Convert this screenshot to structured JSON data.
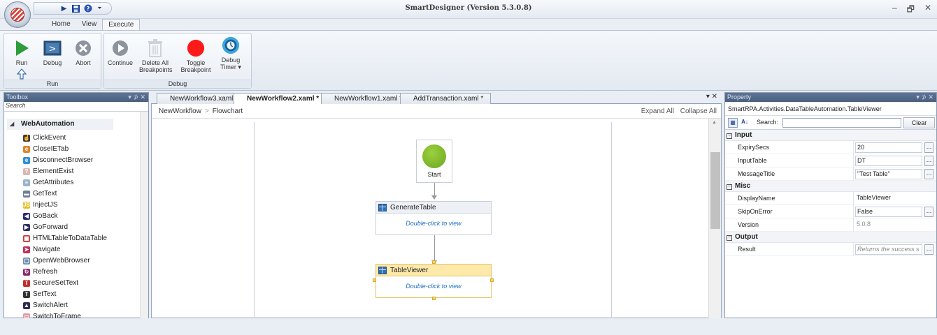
{
  "window": {
    "title": "SmartDesigner (Version 5.3.0.8)",
    "controls": [
      "–",
      "🗗",
      "✕"
    ]
  },
  "ribbon": {
    "tabs": [
      "Home",
      "View",
      "Execute"
    ],
    "active_tab": "Execute",
    "groups": {
      "run": {
        "label": "Run",
        "buttons": {
          "run": "Run",
          "debug": "Debug",
          "abort": "Abort"
        }
      },
      "debug": {
        "label": "Debug",
        "buttons": {
          "continue": "Continue",
          "delete_all_1": "Delete All",
          "delete_all_2": "Breakpoints",
          "toggle_1": "Toggle",
          "toggle_2": "Breakpoint",
          "timer_1": "Debug",
          "timer_2": "Timer ▾"
        }
      }
    }
  },
  "toolbox": {
    "title": "Toolbox",
    "controls": "▾ ⊅ ✕",
    "search_placeholder": "Search",
    "category": "WebAutomation",
    "items": [
      {
        "label": "ClickEvent",
        "icon": "hand-pointer-icon",
        "color": "#3a3a3a",
        "glyph": "☝"
      },
      {
        "label": "CloseIETab",
        "icon": "ie-close-tab-icon",
        "color": "#e0852a",
        "glyph": "e"
      },
      {
        "label": "DisconnectBrowser",
        "icon": "disconnect-browser-icon",
        "color": "#2f8fd6",
        "glyph": "e"
      },
      {
        "label": "ElementExist",
        "icon": "element-exist-icon",
        "color": "#d9b8b8",
        "glyph": "?"
      },
      {
        "label": "GetAttributes",
        "icon": "get-attributes-icon",
        "color": "#9bb3cc",
        "glyph": "≡"
      },
      {
        "label": "GetText",
        "icon": "get-text-icon",
        "color": "#6f7f94",
        "glyph": "▬"
      },
      {
        "label": "InjectJS",
        "icon": "inject-js-icon",
        "color": "#e8c12a",
        "glyph": "JS"
      },
      {
        "label": "GoBack",
        "icon": "go-back-icon",
        "color": "#2d2d6a",
        "glyph": "◀"
      },
      {
        "label": "GoForward",
        "icon": "go-forward-icon",
        "color": "#2d2d6a",
        "glyph": "▶"
      },
      {
        "label": "HTMLTableToDataTable",
        "icon": "html-table-icon",
        "color": "#c73a3a",
        "glyph": "▦"
      },
      {
        "label": "Navigate",
        "icon": "navigate-icon",
        "color": "#c12f5a",
        "glyph": "➤"
      },
      {
        "label": "OpenWebBrowser",
        "icon": "open-web-browser-icon",
        "color": "#6f8fb0",
        "glyph": "▢"
      },
      {
        "label": "Refresh",
        "icon": "refresh-icon",
        "color": "#8a2b6a",
        "glyph": "↻"
      },
      {
        "label": "SecureSetText",
        "icon": "secure-set-text-icon",
        "color": "#c02e2e",
        "glyph": "T"
      },
      {
        "label": "SetText",
        "icon": "set-text-icon",
        "color": "#333333",
        "glyph": "T"
      },
      {
        "label": "SwitchAlert",
        "icon": "switch-alert-icon",
        "color": "#2f2b55",
        "glyph": "▲"
      },
      {
        "label": "SwitchToFrame",
        "icon": "switch-frame-icon",
        "color": "#e09aa6",
        "glyph": "▭"
      }
    ]
  },
  "documents": {
    "tabs": [
      "NewWorkflow3.xaml",
      "NewWorkflow2.xaml *",
      "NewWorkflow1.xaml *",
      "AddTransaction.xaml *"
    ],
    "active_tab": "NewWorkflow2.xaml *",
    "controls": "▾ ✕",
    "breadcrumb": [
      "NewWorkflow",
      "Flowchart"
    ],
    "expand_all": "Expand All",
    "collapse_all": "Collapse All",
    "flowchart": {
      "start_label": "Start",
      "activities": [
        {
          "name": "GenerateTable",
          "hint": "Double-click to view",
          "selected": false
        },
        {
          "name": "TableViewer",
          "hint": "Double-click to view",
          "selected": true
        }
      ]
    }
  },
  "property": {
    "title": "Property",
    "controls": "▾ ⊅ ✕",
    "type_name": "SmartRPA.Activities.DataTableAutomation.TableViewer",
    "search_label": "Search:",
    "search_value": "",
    "clear_label": "Clear",
    "categories": [
      {
        "name": "Input",
        "rows": [
          {
            "name": "ExpirySecs",
            "value": "20",
            "style": "box",
            "dots": true
          },
          {
            "name": "InputTable",
            "value": "DT",
            "style": "box",
            "dots": true
          },
          {
            "name": "MessageTitle",
            "value": "\"Test Table\"",
            "style": "box",
            "dots": true
          }
        ]
      },
      {
        "name": "Misc",
        "rows": [
          {
            "name": "DisplayName",
            "value": "TableViewer",
            "style": "plain",
            "dots": false
          },
          {
            "name": "SkipOnError",
            "value": "False",
            "style": "box",
            "dots": true
          },
          {
            "name": "Version",
            "value": "5.0.8",
            "style": "grey",
            "dots": false
          }
        ]
      },
      {
        "name": "Output",
        "rows": [
          {
            "name": "Result",
            "value": "Returns the success s",
            "style": "ital",
            "dots": true
          }
        ]
      }
    ]
  }
}
